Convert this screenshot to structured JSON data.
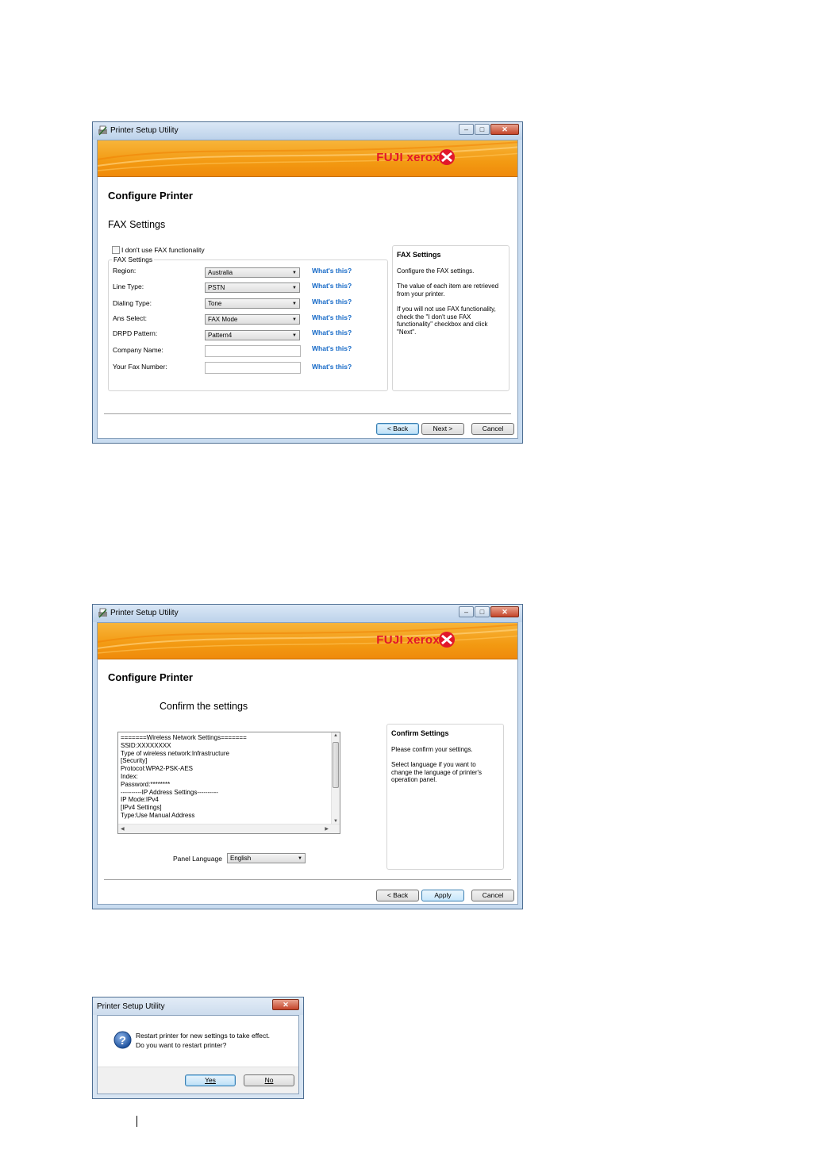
{
  "dialog1": {
    "title": "Printer Setup Utility",
    "brand": "FUJI xerox",
    "heading": "Configure Printer",
    "subheading": "FAX Settings",
    "no_fax_checkbox": "I don't use FAX functionality",
    "group_title": "FAX Settings",
    "fields": [
      {
        "label": "Region:",
        "value": "Australia",
        "type": "select"
      },
      {
        "label": "Line Type:",
        "value": "PSTN",
        "type": "select"
      },
      {
        "label": "Dialing Type:",
        "value": "Tone",
        "type": "select"
      },
      {
        "label": "Ans Select:",
        "value": "FAX Mode",
        "type": "select"
      },
      {
        "label": "DRPD Pattern:",
        "value": "Pattern4",
        "type": "select"
      },
      {
        "label": "Company Name:",
        "value": "",
        "type": "text"
      },
      {
        "label": "Your Fax Number:",
        "value": "",
        "type": "text"
      }
    ],
    "whats_this": "What's this?",
    "help_title": "FAX Settings",
    "help_p1": "Configure the FAX settings.",
    "help_p2": "The value of each item are retrieved from your printer.",
    "help_p3": "If you will not use FAX functionality, check the \"I don't use FAX functionality\" checkbox and click \"Next\".",
    "back": "< Back",
    "next": "Next >",
    "cancel": "Cancel"
  },
  "dialog2": {
    "title": "Printer Setup Utility",
    "brand": "FUJI xerox",
    "heading": "Configure Printer",
    "subheading": "Confirm the settings",
    "settings_lines": [
      "=======Wireless Network Settings=======",
      "SSID:XXXXXXXX",
      "Type of wireless network:Infrastructure",
      "[Security]",
      "Protocol:WPA2-PSK-AES",
      "Index:",
      "Password:********",
      "----------IP Address Settings----------",
      "IP Mode:IPv4",
      "[IPv4 Settings]",
      "Type:Use Manual Address"
    ],
    "panel_language_label": "Panel Language",
    "panel_language_value": "English",
    "help_title": "Confirm Settings",
    "help_p1": "Please confirm your settings.",
    "help_p2": "Select language if you want to change the language of printer's operation panel.",
    "back": "< Back",
    "apply": "Apply",
    "cancel": "Cancel"
  },
  "dialog3": {
    "title": "Printer Setup Utility",
    "message_line1": "Restart printer for new settings to take effect.",
    "message_line2": "Do you want to restart printer?",
    "yes": "Yes",
    "no": "No"
  },
  "colors": {
    "banner_orange": "#f39a12",
    "brand_red": "#e2172a",
    "link_blue": "#1569c7",
    "frame_blue": "#c9dcf0"
  },
  "icons": {
    "title_icon": "printer-setup-icon",
    "question_icon": "question-icon",
    "logo_mark": "xerox-x-mark-icon"
  }
}
